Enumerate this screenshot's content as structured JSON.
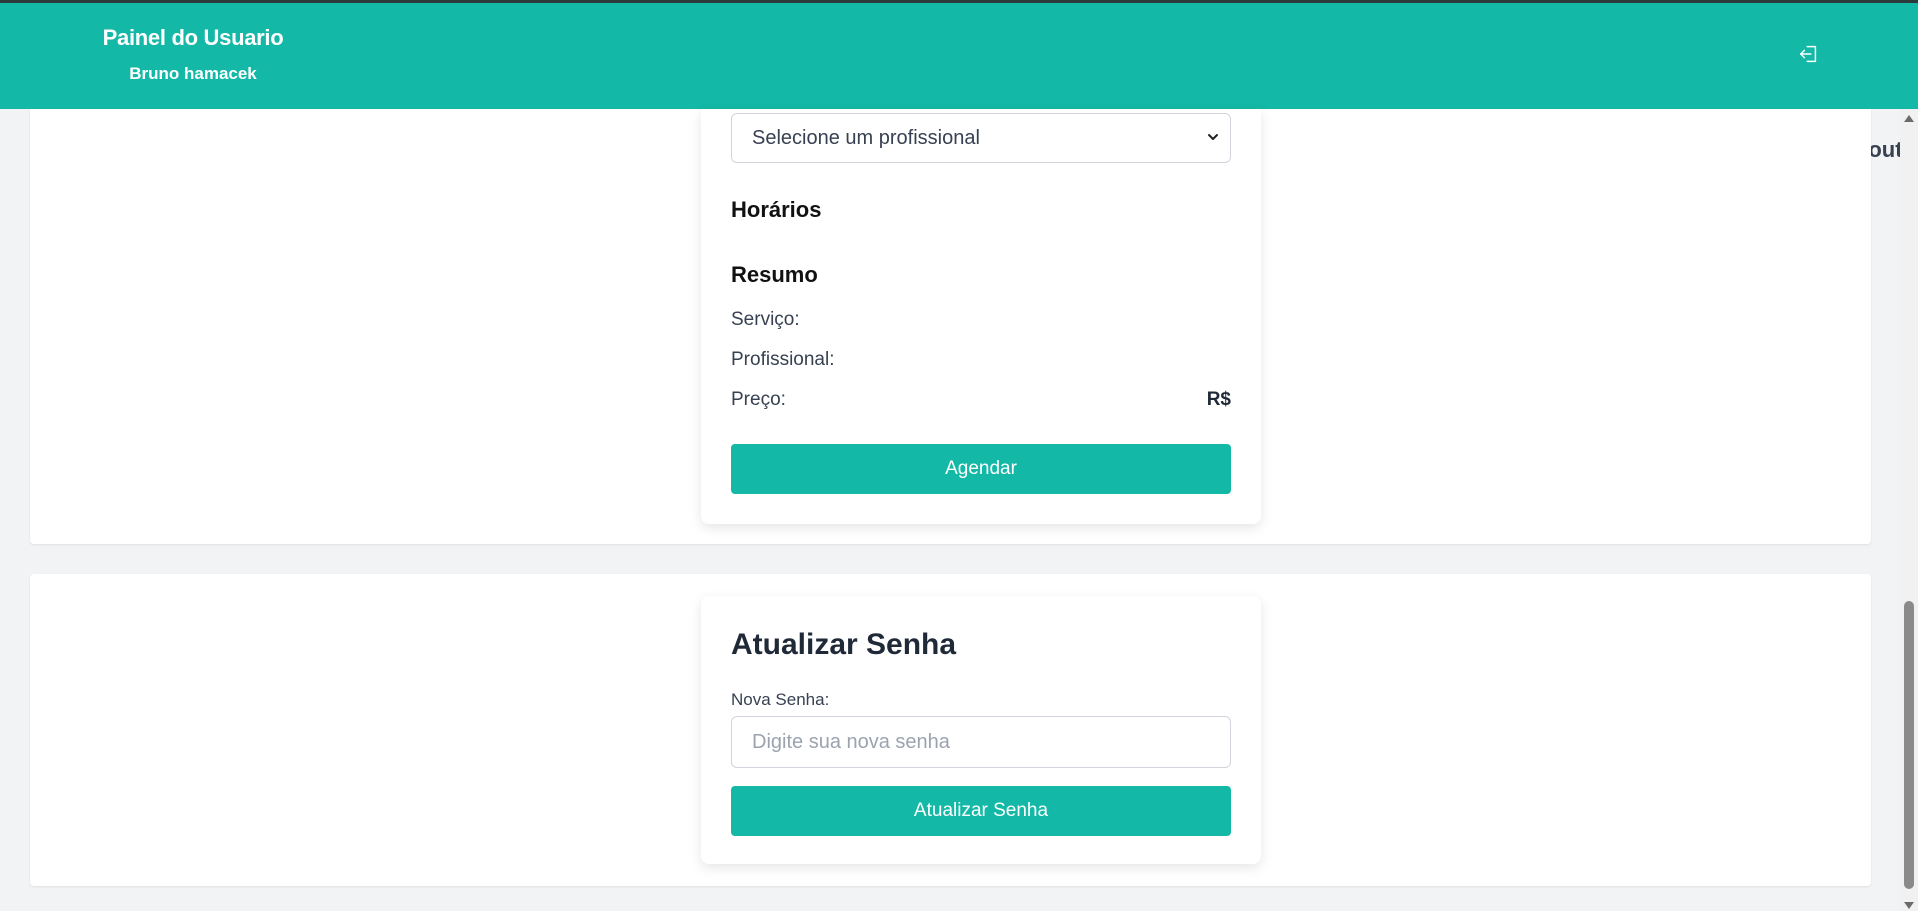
{
  "header": {
    "title": "Painel do Usuario",
    "user_name": "Bruno hamacek",
    "logout_label": "Logout"
  },
  "booking": {
    "professional_select": "Selecione um profissional",
    "schedules_heading": "Horários",
    "summary_heading": "Resumo",
    "service_label": "Serviço:",
    "professional_label": "Profissional:",
    "price_label": "Preço:",
    "price_value": "R$",
    "submit_label": "Agendar"
  },
  "password": {
    "heading": "Atualizar Senha",
    "field_label": "Nova Senha:",
    "placeholder": "Digite sua nova senha",
    "submit_label": "Atualizar Senha"
  },
  "colors": {
    "accent": "#14b8a6",
    "background": "#f2f3f5"
  }
}
